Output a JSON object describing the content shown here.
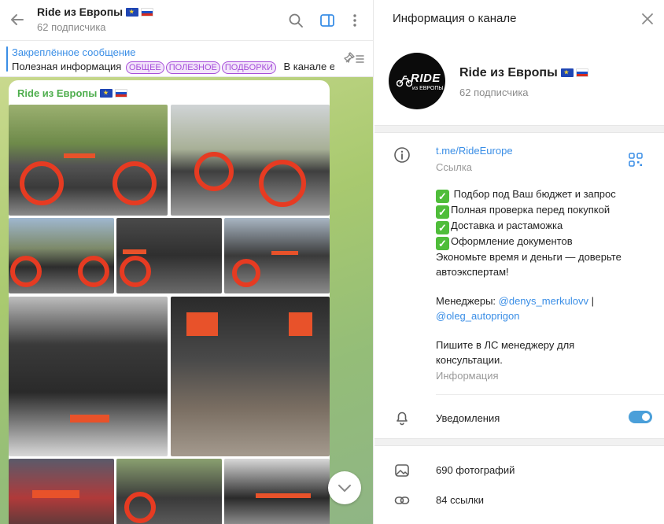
{
  "chat": {
    "title": "Ride из Европы",
    "subscribers": "62 подписчика",
    "pinned": {
      "title": "Закреплённое сообщение",
      "text": "Полезная информация",
      "tags": [
        "ОБЩЕЕ",
        "ПОЛЕЗНОЕ",
        "ПОДБОРКИ"
      ],
      "trailing": "В канале ест..."
    },
    "message": {
      "author": "Ride из Европы"
    }
  },
  "info": {
    "header_title": "Информация о канале",
    "name": "Ride из Европы",
    "subscribers": "62 подписчика",
    "avatar_text": "RIDE",
    "avatar_sub": "из ЕВРОПЫ",
    "link": "t.me/RideEurope",
    "link_label": "Ссылка",
    "description": {
      "items": [
        "Подбор под Ваш бюджет и запрос",
        "Полная проверка перед покупкой",
        "Доставка и растаможка",
        "Оформление документов"
      ],
      "line_economy_1": "Экономьте время и деньги — доверьте",
      "line_economy_2": "автоэкспертам!",
      "managers_prefix": "Менеджеры: ",
      "manager_1": "@denys_merkulovv",
      "managers_sep": " |",
      "manager_2": "@oleg_autoprigon",
      "contact_1": "Пишите в ЛС менеджеру для",
      "contact_2": "консультации."
    },
    "description_label": "Информация",
    "notifications_label": "Уведомления",
    "notifications_on": true,
    "photos": "690 фотографий",
    "links": "84 ссылки"
  },
  "colors": {
    "accent": "#3a8ee6",
    "author": "#4fae4e",
    "tag": "#a64ed9",
    "toggle": "#4a9fd9"
  }
}
